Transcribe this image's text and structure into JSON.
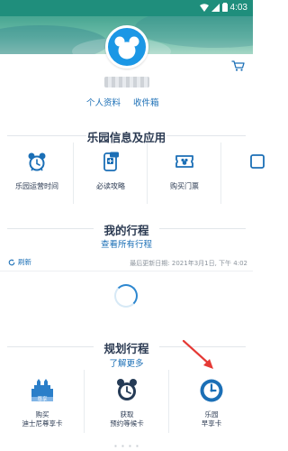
{
  "status_bar": {
    "time": "4:03"
  },
  "profile": {
    "personal_info": "个人资料",
    "inbox": "收件箱"
  },
  "park_info": {
    "title": "乐园信息及应用",
    "items": [
      {
        "label": "乐园运营时间",
        "icon": "alarm-clock-mickey-icon"
      },
      {
        "label": "必读攻略",
        "icon": "phone-guide-icon"
      },
      {
        "label": "购买门票",
        "icon": "ticket-icon"
      },
      {
        "label": "",
        "icon": "partial-icon"
      }
    ]
  },
  "itinerary": {
    "title": "我的行程",
    "view_all": "查看所有行程",
    "refresh": "刷新",
    "last_updated": "最后更新日期: 2021年3月1日, 下午 4:02"
  },
  "plan": {
    "title": "规划行程",
    "learn_more": "了解更多",
    "items": [
      {
        "line1": "购买",
        "line2": "迪士尼尊享卡",
        "icon": "premier-access-icon"
      },
      {
        "line1": "获取",
        "line2": "预约等候卡",
        "icon": "return-time-card-icon"
      },
      {
        "line1": "乐园",
        "line2": "早享卡",
        "icon": "early-park-entry-icon"
      }
    ]
  },
  "colors": {
    "status_bar": "#1f8e7c",
    "brand_blue": "#1b97e5",
    "link_blue": "#1b6fb6",
    "title_text": "#2b3a52",
    "annotation_arrow": "#e53935"
  }
}
